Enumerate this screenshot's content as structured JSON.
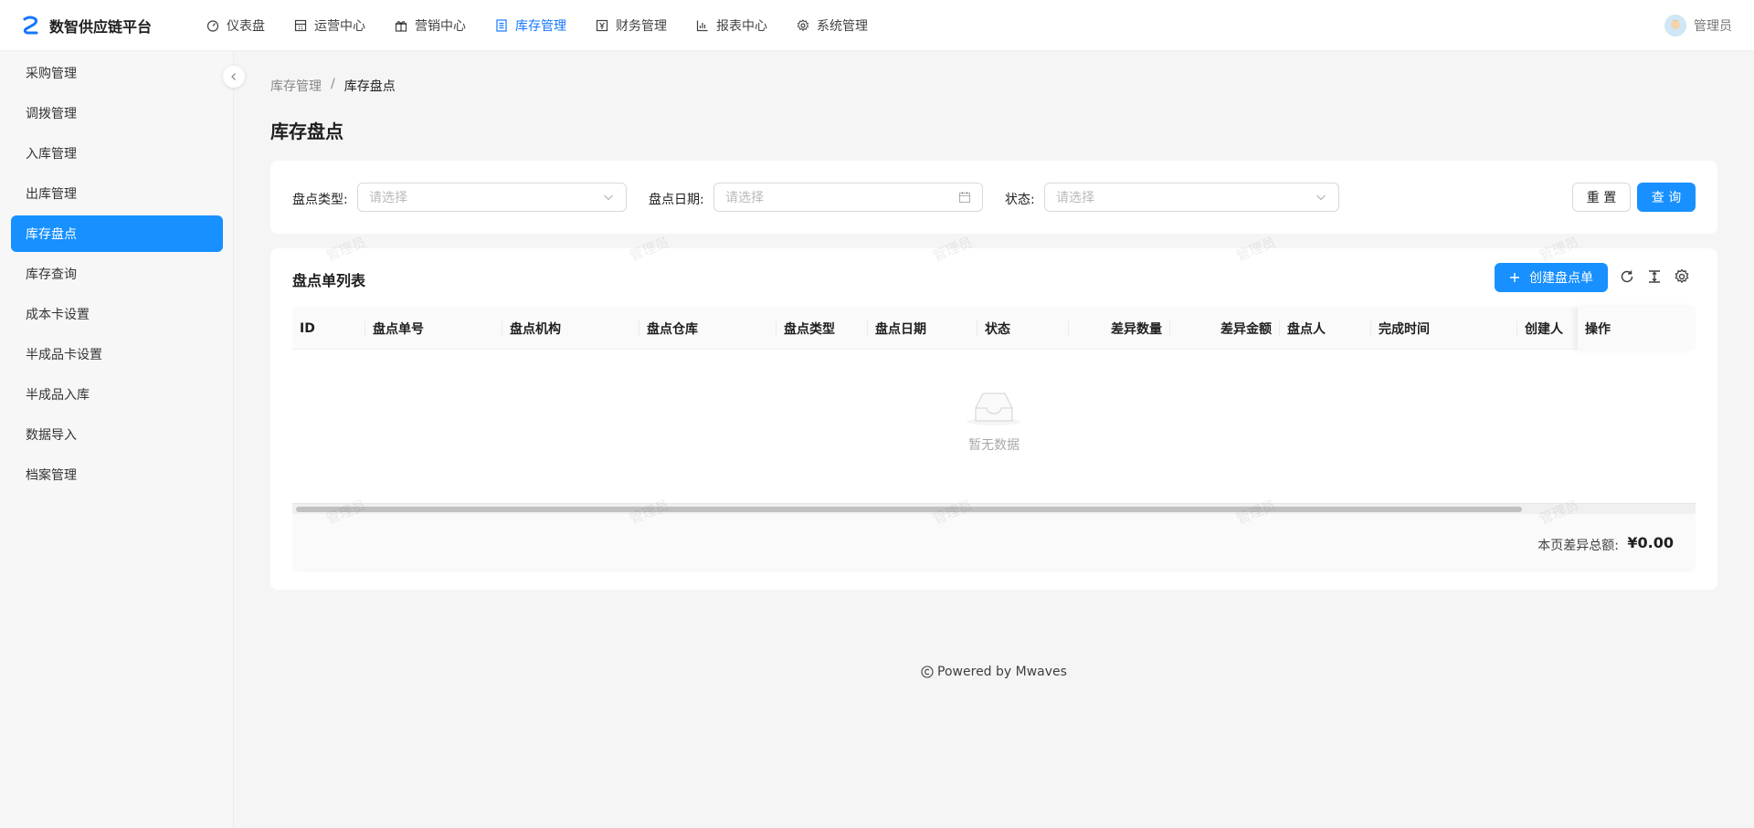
{
  "app": {
    "title": "数智供应链平台"
  },
  "topnav": [
    {
      "label": "仪表盘",
      "icon": "dashboard-icon",
      "active": false
    },
    {
      "label": "运营中心",
      "icon": "calculator-icon",
      "active": false
    },
    {
      "label": "营销中心",
      "icon": "gift-icon",
      "active": false
    },
    {
      "label": "库存管理",
      "icon": "document-list-icon",
      "active": true
    },
    {
      "label": "财务管理",
      "icon": "yen-box-icon",
      "active": false
    },
    {
      "label": "报表中心",
      "icon": "bar-chart-icon",
      "active": false
    },
    {
      "label": "系统管理",
      "icon": "gear-icon",
      "active": false
    }
  ],
  "user": {
    "name": "管理员"
  },
  "sidebar": {
    "items": [
      {
        "label": "采购管理",
        "active": false
      },
      {
        "label": "调拨管理",
        "active": false
      },
      {
        "label": "入库管理",
        "active": false
      },
      {
        "label": "出库管理",
        "active": false
      },
      {
        "label": "库存盘点",
        "active": true
      },
      {
        "label": "库存查询",
        "active": false
      },
      {
        "label": "成本卡设置",
        "active": false
      },
      {
        "label": "半成品卡设置",
        "active": false
      },
      {
        "label": "半成品入库",
        "active": false
      },
      {
        "label": "数据导入",
        "active": false
      },
      {
        "label": "档案管理",
        "active": false
      }
    ]
  },
  "breadcrumb": {
    "parent": "库存管理",
    "separator": "/",
    "current": "库存盘点"
  },
  "page": {
    "title": "库存盘点"
  },
  "filters": {
    "type": {
      "label": "盘点类型",
      "placeholder": "请选择"
    },
    "date": {
      "label": "盘点日期",
      "placeholder": "请选择"
    },
    "status": {
      "label": "状态",
      "placeholder": "请选择"
    },
    "colon": ":",
    "reset_label": "重 置",
    "query_label": "查 询"
  },
  "table": {
    "title": "盘点单列表",
    "create_label": "创建盘点单",
    "columns": [
      "ID",
      "盘点单号",
      "盘点机构",
      "盘点仓库",
      "盘点类型",
      "盘点日期",
      "状态",
      "差异数量",
      "差异金额",
      "盘点人",
      "完成时间",
      "创建人",
      "操作"
    ],
    "empty_text": "暂无数据",
    "summary_label": "本页差异总额:",
    "summary_value": "¥0.00"
  },
  "footer": {
    "text": "Powered by Mwaves"
  },
  "colors": {
    "primary": "#1890ff",
    "active_nav": "#1677ff"
  }
}
